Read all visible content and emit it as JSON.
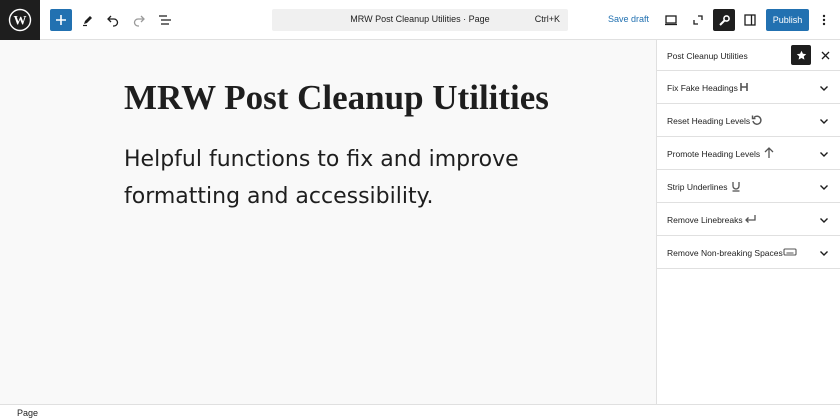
{
  "toolbar": {
    "document_title": "MRW Post Cleanup Utilities · Page",
    "shortcut": "Ctrl+K",
    "save_draft_label": "Save draft",
    "publish_label": "Publish",
    "icons": [
      "wordpress-logo-icon",
      "plus-icon",
      "pencil-icon",
      "undo-icon",
      "redo-icon",
      "list-view-icon",
      "desktop-view-icon",
      "external-link-icon",
      "wrench-icon",
      "sidebar-toggle-icon",
      "more-options-icon"
    ]
  },
  "editor": {
    "title": "MRW Post Cleanup Utilities",
    "paragraph": "Helpful functions to fix and improve formatting and accessibility."
  },
  "sidebar": {
    "title": "Post Cleanup Utilities",
    "panels": [
      {
        "label": "Fix Fake Headings",
        "icon": "heading-icon"
      },
      {
        "label": "Reset Heading Levels",
        "icon": "reset-icon"
      },
      {
        "label": "Promote Heading Levels",
        "icon": "arrow-up-icon"
      },
      {
        "label": "Strip Underlines",
        "icon": "underline-icon"
      },
      {
        "label": "Remove Linebreaks",
        "icon": "linebreak-icon"
      },
      {
        "label": "Remove Non-breaking Spaces",
        "icon": "nbsp-icon"
      }
    ]
  },
  "footer": {
    "breadcrumb": "Page"
  },
  "colors": {
    "accent": "#2271b1",
    "dark": "#1e1e1e",
    "canvas_bg": "#f9f9f9"
  }
}
